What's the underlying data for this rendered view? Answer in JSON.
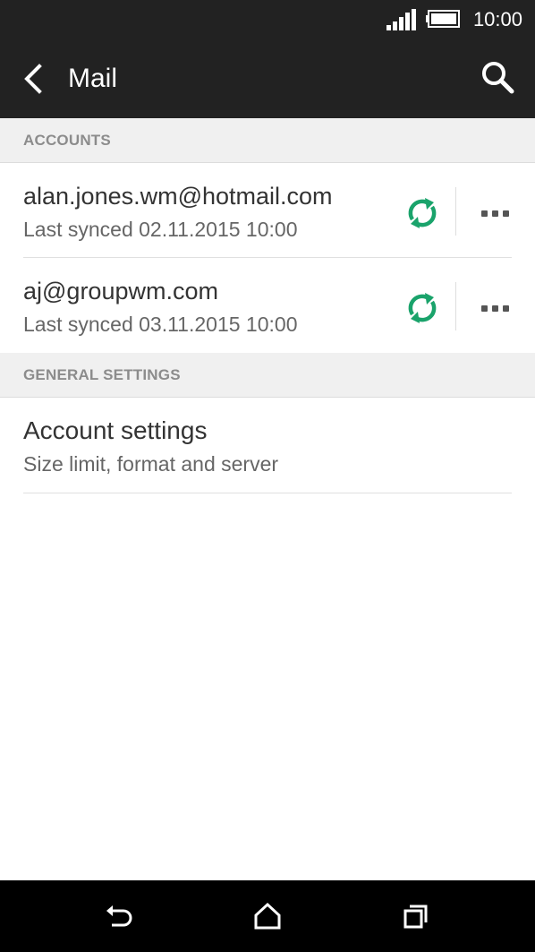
{
  "status_bar": {
    "time": "10:00",
    "icons": [
      "signal-icon",
      "battery-icon"
    ]
  },
  "app_bar": {
    "title": "Mail",
    "icons": [
      "back-arrow-icon",
      "search-icon"
    ]
  },
  "sections": {
    "accounts_header": "ACCOUNTS",
    "general_header": "GENERAL SETTINGS"
  },
  "accounts": [
    {
      "email": "alan.jones.wm@hotmail.com",
      "last_synced": "Last synced 02.11.2015 10:00"
    },
    {
      "email": "aj@groupwm.com",
      "last_synced": "Last synced 03.11.2015 10:00"
    }
  ],
  "account_settings": {
    "title": "Account settings",
    "subtitle": "Size limit, format and server"
  },
  "nav_bar": {
    "icons": [
      "back-nav-icon",
      "home-icon",
      "recent-apps-icon"
    ]
  },
  "colors": {
    "app_bar": "#222222",
    "sync_accent": "#1aa36b",
    "section_header_bg": "#f0f0f0",
    "section_header_text": "#8c8c8c"
  }
}
